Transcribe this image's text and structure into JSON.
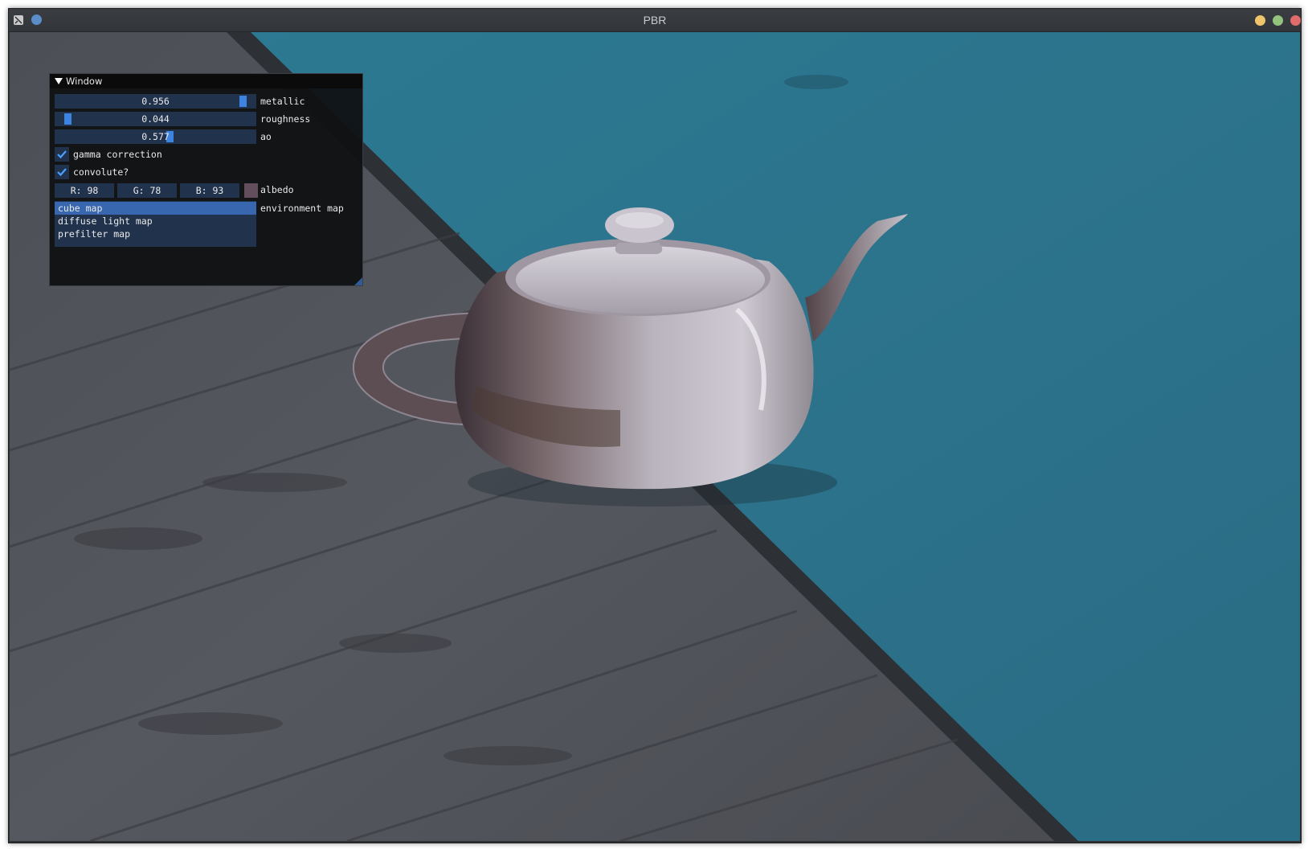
{
  "window": {
    "title": "PBR",
    "icons": {
      "app": "app-icon",
      "pin": "pin-icon",
      "minimize": "minimize-icon",
      "maximize": "maximize-icon",
      "close": "close-icon"
    },
    "colors": {
      "minimize": "#f0c46a",
      "maximize": "#93c47d",
      "close": "#e06c6c",
      "pin": "#5b8ec9"
    }
  },
  "imgui": {
    "title": "Window",
    "sliders": [
      {
        "label": "metallic",
        "value_text": "0.956",
        "value": 0.956
      },
      {
        "label": "roughness",
        "value_text": "0.044",
        "value": 0.044
      },
      {
        "label": "ao",
        "value_text": "0.577",
        "value": 0.577
      }
    ],
    "checkboxes": [
      {
        "label": "gamma correction",
        "checked": true
      },
      {
        "label": "convolute?",
        "checked": true
      }
    ],
    "albedo": {
      "label": "albedo",
      "r_text": "R: 98",
      "g_text": "G: 78",
      "b_text": "B: 93",
      "swatch_color": "#624e5d"
    },
    "environment": {
      "label": "environment map",
      "items": [
        "cube map",
        "diffuse light map",
        "prefilter map"
      ],
      "selected": "cube map"
    },
    "accent_color": "#3d84e0",
    "frame_color": "#21324d"
  },
  "scene": {
    "object": "teapot",
    "floor": "wooden deck",
    "water_color": "#2b6f86"
  }
}
